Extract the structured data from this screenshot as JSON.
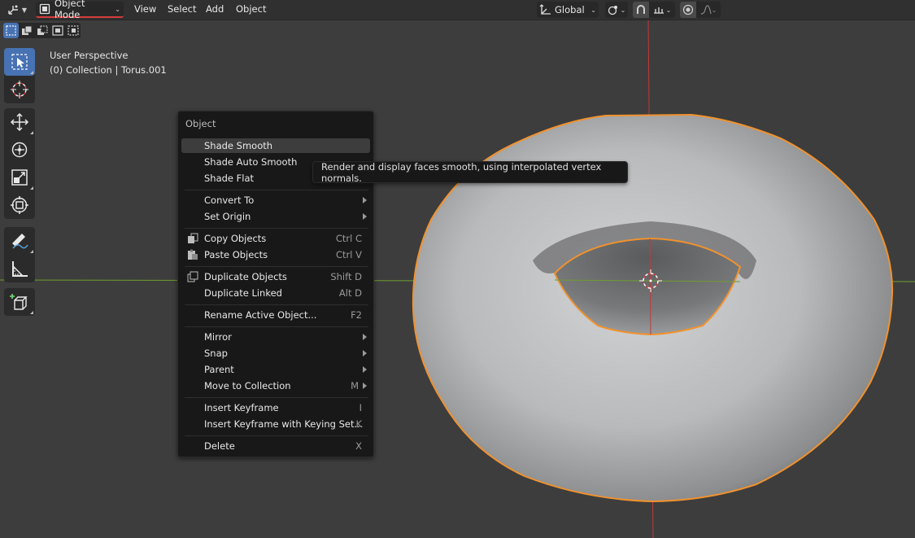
{
  "header": {
    "mode_label": "Object Mode",
    "menus": [
      "View",
      "Select",
      "Add",
      "Object"
    ],
    "orientation_label": "Global"
  },
  "viewport": {
    "view_name": "User Perspective",
    "collection_info": "(0) Collection | Torus.001"
  },
  "context_menu": {
    "title": "Object",
    "items": [
      {
        "label": "Shade Smooth",
        "shortcut": "",
        "submenu": false,
        "icon": "",
        "highlighted": true
      },
      {
        "label": "Shade Auto Smooth",
        "shortcut": "",
        "submenu": false,
        "icon": ""
      },
      {
        "label": "Shade Flat",
        "shortcut": "",
        "submenu": false,
        "icon": ""
      },
      {
        "label": "Convert To",
        "shortcut": "",
        "submenu": true,
        "icon": ""
      },
      {
        "label": "Set Origin",
        "shortcut": "",
        "submenu": true,
        "icon": ""
      },
      {
        "label": "Copy Objects",
        "shortcut": "Ctrl C",
        "submenu": false,
        "icon": "copy-icon"
      },
      {
        "label": "Paste Objects",
        "shortcut": "Ctrl V",
        "submenu": false,
        "icon": "paste-icon"
      },
      {
        "label": "Duplicate Objects",
        "shortcut": "Shift D",
        "submenu": false,
        "icon": "duplicate-icon"
      },
      {
        "label": "Duplicate Linked",
        "shortcut": "Alt D",
        "submenu": false,
        "icon": ""
      },
      {
        "label": "Rename Active Object...",
        "shortcut": "F2",
        "submenu": false,
        "icon": ""
      },
      {
        "label": "Mirror",
        "shortcut": "",
        "submenu": true,
        "icon": ""
      },
      {
        "label": "Snap",
        "shortcut": "",
        "submenu": true,
        "icon": ""
      },
      {
        "label": "Parent",
        "shortcut": "",
        "submenu": true,
        "icon": ""
      },
      {
        "label": "Move to Collection",
        "shortcut": "M",
        "submenu": true,
        "icon": ""
      },
      {
        "label": "Insert Keyframe",
        "shortcut": "I",
        "submenu": false,
        "icon": ""
      },
      {
        "label": "Insert Keyframe with Keying Set...",
        "shortcut": "K",
        "submenu": false,
        "icon": ""
      },
      {
        "label": "Delete",
        "shortcut": "X",
        "submenu": false,
        "icon": ""
      }
    ]
  },
  "tooltip": {
    "text": "Render and display faces smooth, using interpolated vertex normals."
  },
  "colors": {
    "accent": "#4772b3",
    "selection_outline": "#f0922e",
    "x_axis": "#c23a3a",
    "y_axis": "#6f9e2e"
  }
}
